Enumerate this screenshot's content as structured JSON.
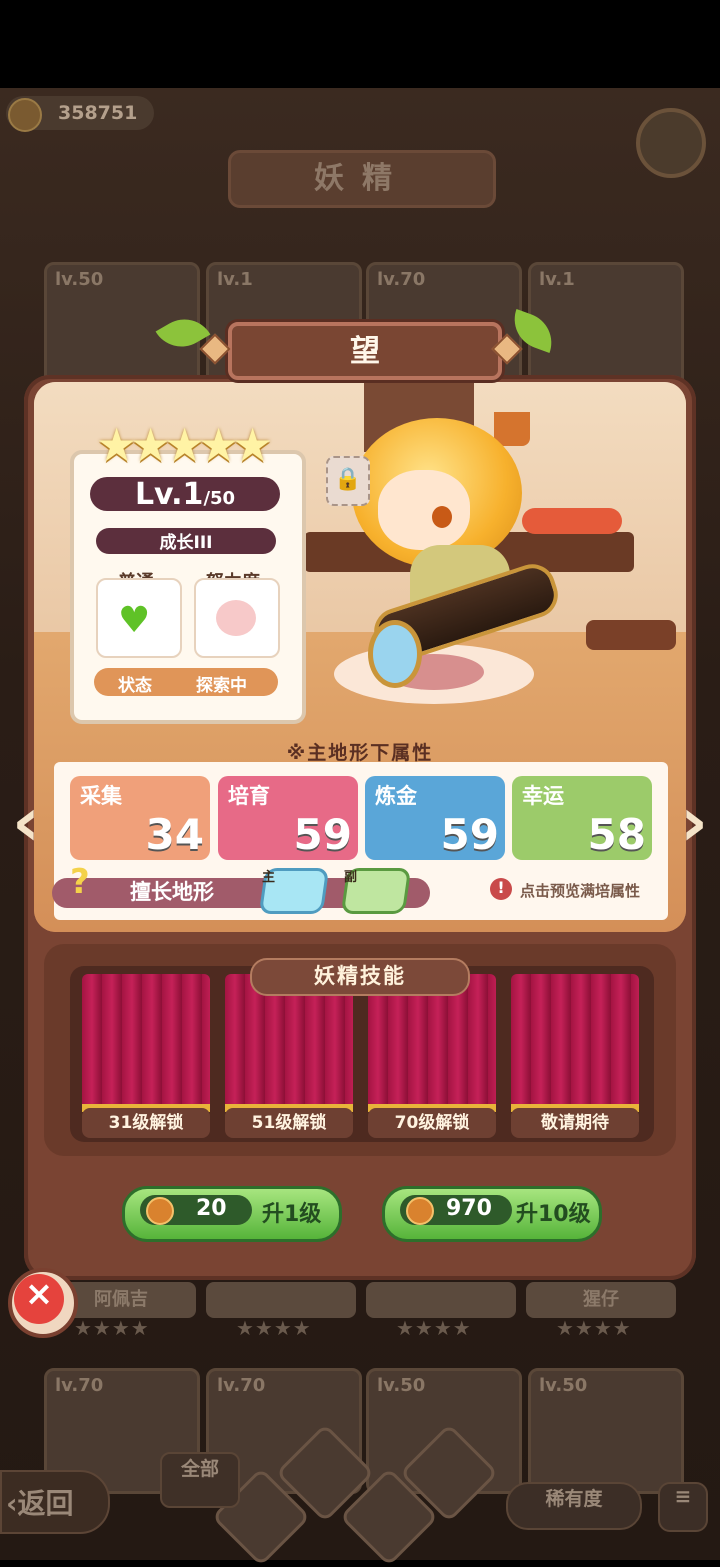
{
  "header": {
    "coins": "358751",
    "title": "妖精"
  },
  "background_cards": {
    "top_row": [
      {
        "level": "lv.50"
      },
      {
        "level": "lv.1"
      },
      {
        "level": "lv.70"
      },
      {
        "level": "lv.1"
      }
    ],
    "middle_row": [
      {
        "name": "阿佩吉",
        "stars": "★★★★"
      },
      {
        "name": "",
        "stars": "★★★★"
      },
      {
        "name": "",
        "stars": "★★★★"
      },
      {
        "name": "猩仔",
        "stars": "★★★★"
      }
    ],
    "bottom_row": [
      {
        "level": "lv.70"
      },
      {
        "level": "lv.70"
      },
      {
        "level": "lv.50"
      },
      {
        "level": "lv.50"
      }
    ]
  },
  "fairy": {
    "name": "望",
    "stars": 5,
    "level": "Lv.1",
    "level_max": "/50",
    "growth": "成长III",
    "mood_label": "普通",
    "effort_label": "努力度",
    "status_label": "状态",
    "status_value": "探索中"
  },
  "attributes": {
    "title": "※主地形下属性",
    "items": [
      {
        "name": "采集",
        "value": "34",
        "color": "#f0a07a"
      },
      {
        "name": "培育",
        "value": "59",
        "color": "#e76a87"
      },
      {
        "name": "炼金",
        "value": "59",
        "color": "#5aa6d8"
      },
      {
        "name": "幸运",
        "value": "58",
        "color": "#9ccb6a"
      }
    ],
    "terrain_label": "擅长地形",
    "terrain_main_tag": "主",
    "terrain_sub_tag": "副",
    "preview_text": "点击预览满培属性"
  },
  "skills": {
    "title": "妖精技能",
    "slots": [
      "31级解锁",
      "51级解锁",
      "70级解锁",
      "敬请期待"
    ]
  },
  "upgrades": [
    {
      "cost": "20",
      "label": "升1级"
    },
    {
      "cost": "970",
      "label": "升10级"
    }
  ],
  "bottom": {
    "back_label": "返回",
    "all_label": "全部",
    "rarity_label": "稀有度"
  }
}
